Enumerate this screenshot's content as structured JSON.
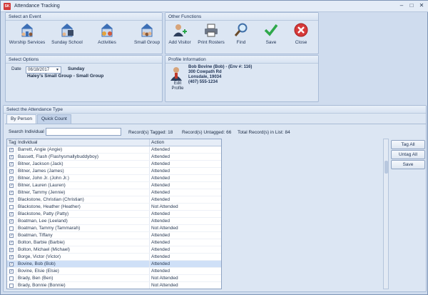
{
  "window": {
    "title": "Attendance Tracking",
    "app_icon": "SK"
  },
  "events_panel": {
    "title": "Select an Event",
    "items": [
      {
        "label": "Worship Services",
        "icon": "church-icon"
      },
      {
        "label": "Sunday School",
        "icon": "school-icon"
      },
      {
        "label": "Activities",
        "icon": "activities-icon"
      },
      {
        "label": "Small Group",
        "icon": "small-group-icon"
      }
    ]
  },
  "functions_panel": {
    "title": "Other Functions",
    "items": [
      {
        "label": "Add Visitor",
        "icon": "add-visitor-icon"
      },
      {
        "label": "Print Rosters",
        "icon": "printer-icon"
      },
      {
        "label": "Find",
        "icon": "magnifier-icon"
      },
      {
        "label": "Save",
        "icon": "checkmark-icon"
      },
      {
        "label": "Close",
        "icon": "close-icon"
      }
    ]
  },
  "options_panel": {
    "title": "Select Options",
    "date_label": "Date",
    "date_value": "06/18/2017",
    "day_name": "Sunday",
    "group_name": "Haley's Small Group - Small Group"
  },
  "profile_panel": {
    "title": "Profile Information",
    "edit_label": "Edit Profile",
    "lines": [
      "Bob Bovine (Bob) - (Env #: 116)",
      "300 Cowpath Rd",
      "Lonsdale, 19034",
      "(407) 555-1234"
    ]
  },
  "attendance": {
    "section_title": "Select the Attendance Type",
    "tabs": [
      "By Person",
      "Quick Count"
    ],
    "search_label": "Search Individual",
    "search_value": "",
    "tagged_label": "Record(s) Tagged: 18",
    "untagged_label": "Record(s) Untagged: 66",
    "total_label": "Total Record(s) in List: 84",
    "columns": [
      "Tag",
      "Individual",
      "Action"
    ],
    "rows": [
      {
        "tag": true,
        "name": "Barrett, Angie (Angie)",
        "action": "Attended"
      },
      {
        "tag": true,
        "name": "Bassett, Flash (Flashysmallybuddyboy)",
        "action": "Attended"
      },
      {
        "tag": true,
        "name": "Bitner, Jackson (Jack)",
        "action": "Attended"
      },
      {
        "tag": true,
        "name": "Bitner, James (James)",
        "action": "Attended"
      },
      {
        "tag": true,
        "name": "Bitner, John Jr. (John Jr.)",
        "action": "Attended"
      },
      {
        "tag": true,
        "name": "Bitner, Lauren (Lauren)",
        "action": "Attended"
      },
      {
        "tag": true,
        "name": "Bitner, Tammy (Jennie)",
        "action": "Attended"
      },
      {
        "tag": true,
        "name": "Blackstone, Christian (Christian)",
        "action": "Attended"
      },
      {
        "tag": false,
        "name": "Blackstone, Heather (Heather)",
        "action": "Not Attended"
      },
      {
        "tag": true,
        "name": "Blackstone, Patty (Patty)",
        "action": "Attended"
      },
      {
        "tag": true,
        "name": "Boatman, Lee (Leeland)",
        "action": "Attended"
      },
      {
        "tag": false,
        "name": "Boatman, Tammy (Tammarah)",
        "action": "Not Attended"
      },
      {
        "tag": true,
        "name": "Boatman, Tiffany",
        "action": "Attended"
      },
      {
        "tag": true,
        "name": "Bolton, Barbie (Barbie)",
        "action": "Attended"
      },
      {
        "tag": true,
        "name": "Bolton, Michael (Michael)",
        "action": "Attended"
      },
      {
        "tag": true,
        "name": "Borge, Victor (Victor)",
        "action": "Attended"
      },
      {
        "tag": true,
        "name": "Bovine, Bob (Bob)",
        "action": "Attended",
        "selected": true
      },
      {
        "tag": true,
        "name": "Bovine, Elsie (Elsie)",
        "action": "Attended"
      },
      {
        "tag": false,
        "name": "Brady, Ben (Ben)",
        "action": "Not Attended"
      },
      {
        "tag": false,
        "name": "Brady, Bonnie (Bonnie)",
        "action": "Not Attended"
      }
    ],
    "buttons": [
      "Tag All",
      "Untag All",
      "Save"
    ]
  }
}
